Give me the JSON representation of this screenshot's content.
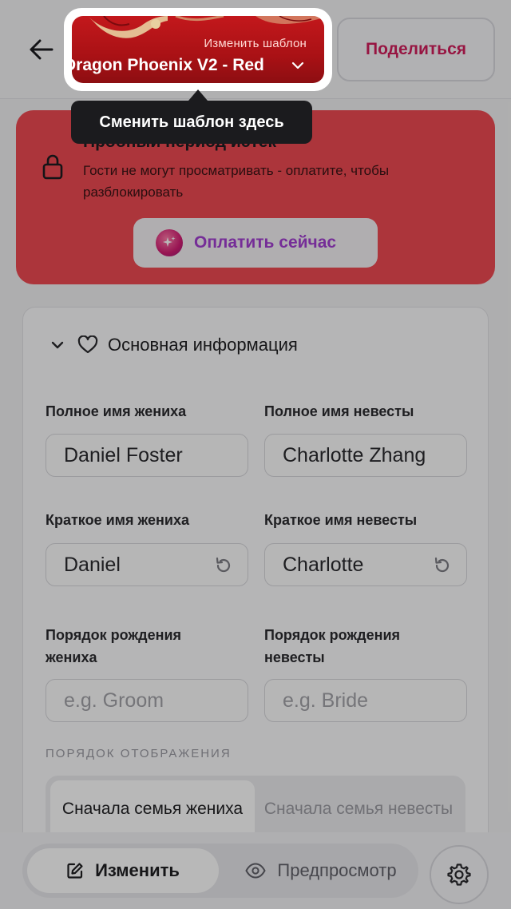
{
  "header": {
    "template_subtitle": "Изменить шаблон",
    "template_name": "Dragon Phoenix V2 - Red",
    "share_label": "Поделиться"
  },
  "tooltip": {
    "text": "Сменить шаблон здесь"
  },
  "trial": {
    "title": "Пробный период истек",
    "description": "Гости не могут просматривать - оплатите, чтобы разблокировать",
    "pay_label": "Оплатить сейчас"
  },
  "basic_info": {
    "section_title": "Основная информация",
    "groom_full_label": "Полное имя жениха",
    "groom_full_value": "Daniel Foster",
    "bride_full_label": "Полное имя невесты",
    "bride_full_value": "Charlotte Zhang",
    "groom_short_label": "Краткое имя жениха",
    "groom_short_value": "Daniel",
    "bride_short_label": "Краткое имя невесты",
    "bride_short_value": "Charlotte",
    "groom_order_label": "Порядок рождения жениха",
    "groom_order_placeholder": "e.g. Groom",
    "bride_order_label": "Порядок рождения невесты",
    "bride_order_placeholder": "e.g. Bride",
    "display_order_label": "ПОРЯДОК ОТОБРАЖЕНИЯ",
    "order_options": [
      "Сначала семья жениха",
      "Сначала семья невесты"
    ]
  },
  "bottom_bar": {
    "edit_label": "Изменить",
    "preview_label": "Предпросмотр"
  },
  "colors": {
    "template_red": "#b8161b",
    "share_text": "#d21e5c",
    "trial_banner": "#ef4a53",
    "pay_text": "#a23fd2"
  }
}
